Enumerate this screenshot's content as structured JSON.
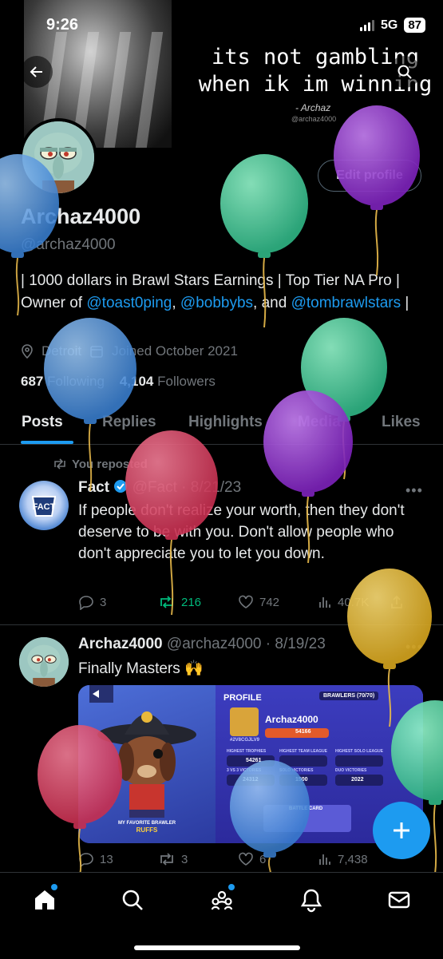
{
  "status_bar": {
    "time": "9:26",
    "network": "5G",
    "battery": "87"
  },
  "banner": {
    "quote": "its not gambling when ik im winning",
    "author": "- Archaz",
    "handle": "@archaz4000"
  },
  "profile": {
    "display_name": "Archaz4000",
    "handle": "@archaz4000",
    "edit_label": "Edit profile",
    "bio_part1": "| 1000 dollars in Brawl Stars Earnings | Top Tier NA Pro | Owner of ",
    "bio_link1": "@toast0ping",
    "bio_sep1": ", ",
    "bio_link2": "@bobbybs",
    "bio_sep2": ", and ",
    "bio_link3": "@tombrawlstars",
    "bio_end": " |",
    "location": "Detroit",
    "joined": "Joined October 2021",
    "following_count": "687",
    "following_label": "Following",
    "followers_count": "4,104",
    "followers_label": "Followers"
  },
  "tabs": [
    "Posts",
    "Replies",
    "Highlights",
    "Media",
    "Likes"
  ],
  "posts": [
    {
      "repost_label": "You reposted",
      "name": "Fact",
      "handle": "@Fact",
      "date": "8/21/23",
      "text": "If people don't realize your worth, then they don't deserve to be with you. Don't allow people who don't appreciate you to let you down.",
      "replies": "3",
      "reposts": "216",
      "likes": "742",
      "views": "40.7K"
    },
    {
      "name": "Archaz4000",
      "handle": "@archaz4000",
      "date": "8/19/23",
      "text": "Finally Masters 🙌",
      "replies": "13",
      "reposts": "3",
      "likes": "6",
      "views": "7,438"
    }
  ],
  "game_image": {
    "profile": "PROFILE",
    "brawlers": "BRAWLERS (70/70)",
    "player_name": "Archaz4000",
    "tag": "#2V8CGJLV9",
    "trophies": "54166",
    "highest_trophies_label": "HIGHEST TROPHIES",
    "highest_trophies": "54261",
    "highest_team_label": "HIGHEST TEAM LEAGUE",
    "highest_solo_label": "HIGHEST SOLO LEAGUE",
    "vs_label": "3 VS 3 VICTORIES",
    "vs_value": "24312",
    "solo_label": "SOLO VICTORIES",
    "solo_value": "1500",
    "duo_label": "DUO VICTORIES",
    "duo_value": "2022",
    "favorite_label": "MY FAVORITE BRAWLER",
    "favorite_name": "RUFFS",
    "battle_card": "BATTLE CARD"
  },
  "colors": {
    "accent": "#1d9bf0",
    "repost_green": "#00ba7c",
    "balloon_blue": "#4a90d9",
    "balloon_green": "#3ec99a",
    "balloon_purple": "#8e2fc9",
    "balloon_red": "#d63c5e",
    "balloon_yellow": "#e0b32f"
  }
}
